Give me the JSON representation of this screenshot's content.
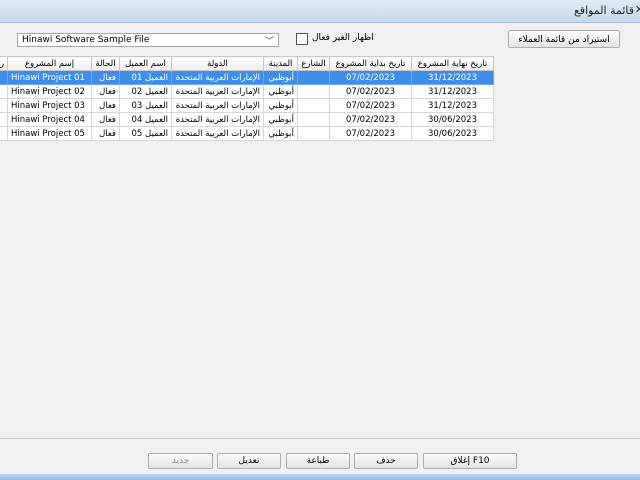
{
  "window": {
    "title": "قائمة المواقع",
    "close_icon": "close-icon"
  },
  "toolbar": {
    "import_label": "استيراد من قائمة العملاء",
    "show_inactive_label": "اظهار الغير فعال",
    "show_inactive_checked": false,
    "file_value": "Hinawi Software Sample File",
    "dropdown_icon": "chevron-down-icon"
  },
  "table": {
    "columns": [
      "ر",
      "إسم المشروع",
      "الحالة",
      "اسم العميل",
      "الدولة",
      "المدينة",
      "الشارع",
      "تاريخ بداية المشروع",
      "تاريخ نهاية المشروع"
    ],
    "rows": [
      [
        "",
        "Hinawi Project 01",
        "فعال",
        "العميل 01",
        "الإمارات العربية المتحدة",
        "أبوظبي",
        "",
        "07/02/2023",
        "31/12/2023"
      ],
      [
        "",
        "Hinawi Project 02",
        "فعال",
        "العميل 02",
        "الإمارات العربية المتحدة",
        "أبوظبي",
        "",
        "07/02/2023",
        "31/12/2023"
      ],
      [
        "",
        "Hinawi Project 03",
        "فعال",
        "العميل 03",
        "الإمارات العربية المتحدة",
        "أبوظبي",
        "",
        "07/02/2023",
        "31/12/2023"
      ],
      [
        "",
        "Hinawi Project 04",
        "فعال",
        "العميل 04",
        "الإمارات العربية المتحدة",
        "أبوظبي",
        "",
        "07/02/2023",
        "30/06/2023"
      ],
      [
        "",
        "Hinawi Project 05",
        "فعال",
        "العميل 05",
        "الإمارات العربية المتحدة",
        "أبوظبي",
        "",
        "07/02/2023",
        "30/06/2023"
      ]
    ],
    "selected_row": 0
  },
  "buttons": {
    "new": "جديد",
    "edit": "تعديل",
    "print": "طباعة",
    "delete": "حذف",
    "close": "F10 إغلاق"
  }
}
